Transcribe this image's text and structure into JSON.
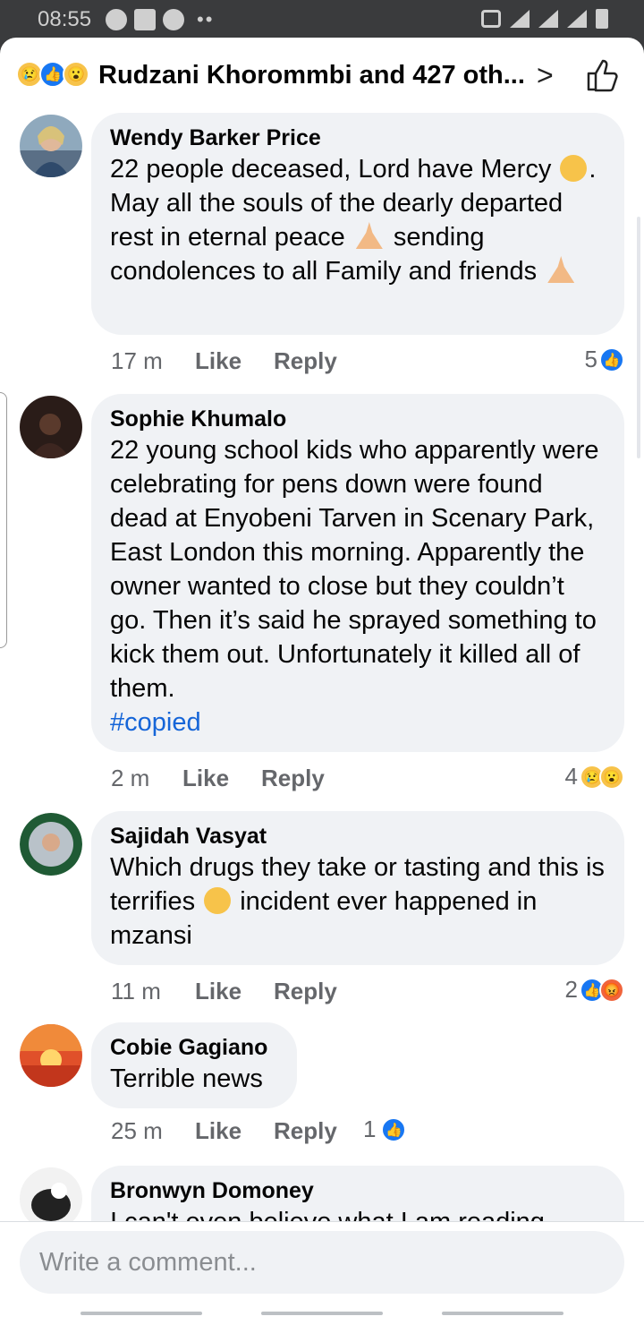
{
  "statusbar": {
    "time": "08:55"
  },
  "header": {
    "reaction_icons": [
      "sad-react",
      "like-react",
      "wow-react"
    ],
    "title": "Rudzani Khorommbi and 427 oth..."
  },
  "comments": [
    {
      "name": "Wendy Barker Price",
      "text_parts": [
        "22 people deceased, Lord have Mercy",
        ". May all the souls of the dearly departed rest in eternal peace",
        "sending condolences to all Family and friends"
      ],
      "time": "17 m",
      "like": "Like",
      "reply": "Reply",
      "reactions_count": "5"
    },
    {
      "name": "Sophie Khumalo",
      "text": "22 young school kids who apparently were celebrating for pens down were found dead at Enyobeni Tarven in Scenary Park, East London this morning. Apparently the owner wanted to close but they couldn’t go. Then it’s said he sprayed something to kick them out. Unfortunately it killed all of them.",
      "hashtag": "#copied",
      "time": "2 m",
      "like": "Like",
      "reply": "Reply",
      "reactions_count": "4"
    },
    {
      "name": "Sajidah Vasyat",
      "text_parts": [
        "Which drugs they take or tasting and this is terrifies",
        "incident ever happened in mzansi"
      ],
      "time": "11 m",
      "like": "Like",
      "reply": "Reply",
      "reactions_count": "2"
    },
    {
      "name": "Cobie Gagiano",
      "text": "Terrible news",
      "time": "25 m",
      "like": "Like",
      "reply": "Reply",
      "reactions_count": "1"
    },
    {
      "name": "Bronwyn Domoney",
      "text": "I can't even believe what I am reading"
    }
  ],
  "composer": {
    "placeholder": "Write a comment..."
  },
  "colors": {
    "accent": "#1877f2",
    "bubble": "#f0f2f5",
    "hashtag": "#1565d8"
  }
}
